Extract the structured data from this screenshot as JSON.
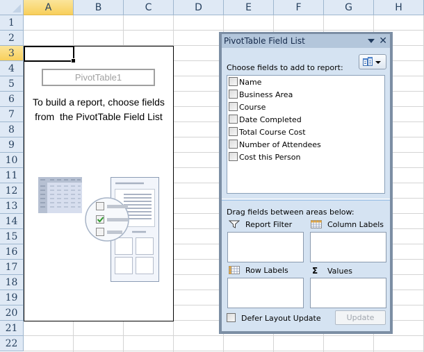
{
  "sheet": {
    "columns": [
      "A",
      "B",
      "C",
      "D",
      "E",
      "F",
      "G",
      "H"
    ],
    "selected_column": "A",
    "rows": [
      "1",
      "2",
      "3",
      "4",
      "5",
      "6",
      "7",
      "8",
      "9",
      "10",
      "11",
      "12",
      "13",
      "14",
      "15",
      "16",
      "17",
      "18",
      "19",
      "20",
      "21",
      "22"
    ],
    "selected_row": "3",
    "active_cell": "A3"
  },
  "pivot_placeholder": {
    "name": "PivotTable1",
    "instruction_line1": "To build a report, choose fields",
    "instruction_line2": "from  the PivotTable Field List"
  },
  "field_list_pane": {
    "title": "PivotTable Field List",
    "title_dropdown_icon": "triangle-down-icon",
    "close_icon": "close-icon",
    "choose_label": "Choose fields to add to report:",
    "layout_button_icon": "field-list-layout-icon",
    "fields": [
      {
        "label": "Name",
        "checked": false
      },
      {
        "label": "Business Area",
        "checked": false
      },
      {
        "label": "Course",
        "checked": false
      },
      {
        "label": "Date Completed",
        "checked": false
      },
      {
        "label": "Total Course Cost",
        "checked": false
      },
      {
        "label": "Number of Attendees",
        "checked": false
      },
      {
        "label": "Cost this Person",
        "checked": false
      }
    ],
    "drag_label": "Drag fields between areas below:",
    "areas": {
      "report_filter": "Report Filter",
      "column_labels": "Column Labels",
      "row_labels": "Row Labels",
      "values": "Values"
    },
    "defer_label": "Defer Layout Update",
    "defer_checked": false,
    "update_button": "Update",
    "update_enabled": false
  }
}
